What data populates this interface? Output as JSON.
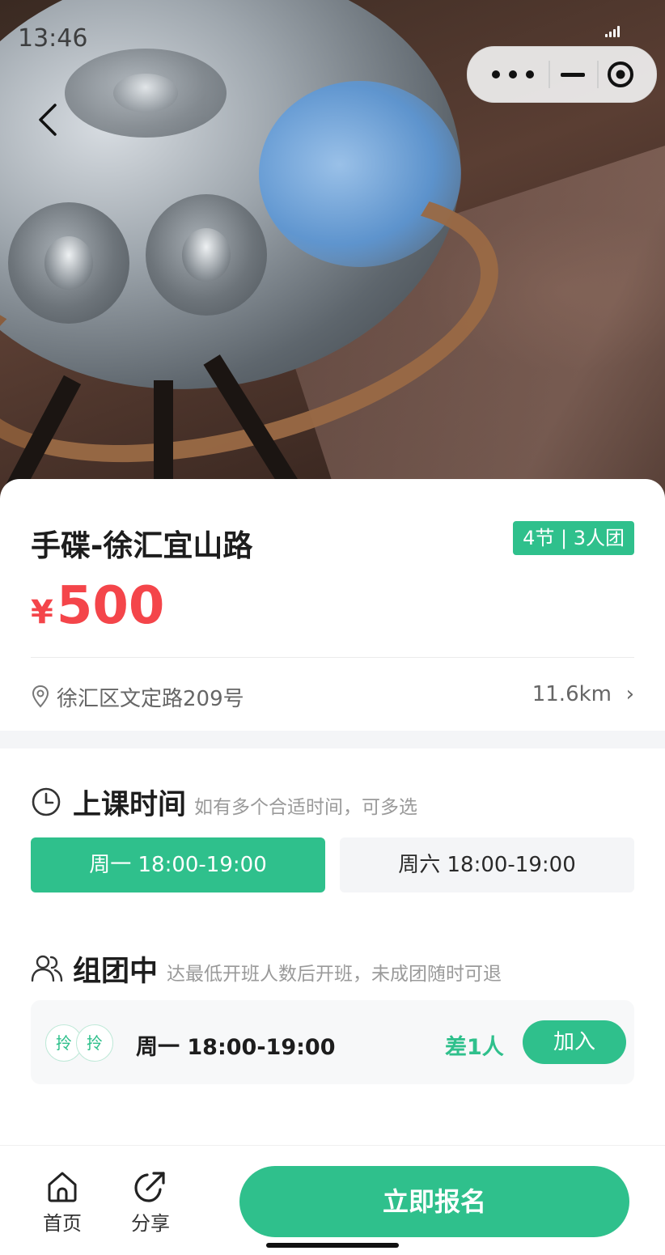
{
  "status_bar": {
    "time": "13:46"
  },
  "hero": {
    "alt": "handpan-photo"
  },
  "course": {
    "title": "手碟-徐汇宜山路",
    "badge": "4节 | 3人团",
    "price_currency": "¥",
    "price": "500",
    "address": "徐汇区文定路209号",
    "distance": "11.6km"
  },
  "schedule": {
    "title": "上课时间",
    "hint": "如有多个合适时间，可多选",
    "slots": [
      {
        "label": "周一 18:00-19:00",
        "selected": true
      },
      {
        "label": "周六 18:00-19:00",
        "selected": false
      }
    ]
  },
  "group": {
    "title": "组团中",
    "hint": "达最低开班人数后开班，未成团随时可退",
    "items": [
      {
        "avatar_text": "拎",
        "time": "周一 18:00-19:00",
        "short": "差1人",
        "join_label": "加入"
      }
    ]
  },
  "bottom_bar": {
    "home_label": "首页",
    "share_label": "分享",
    "enroll_label": "立即报名"
  },
  "colors": {
    "accent": "#2fc08c",
    "price": "#f4454a"
  }
}
